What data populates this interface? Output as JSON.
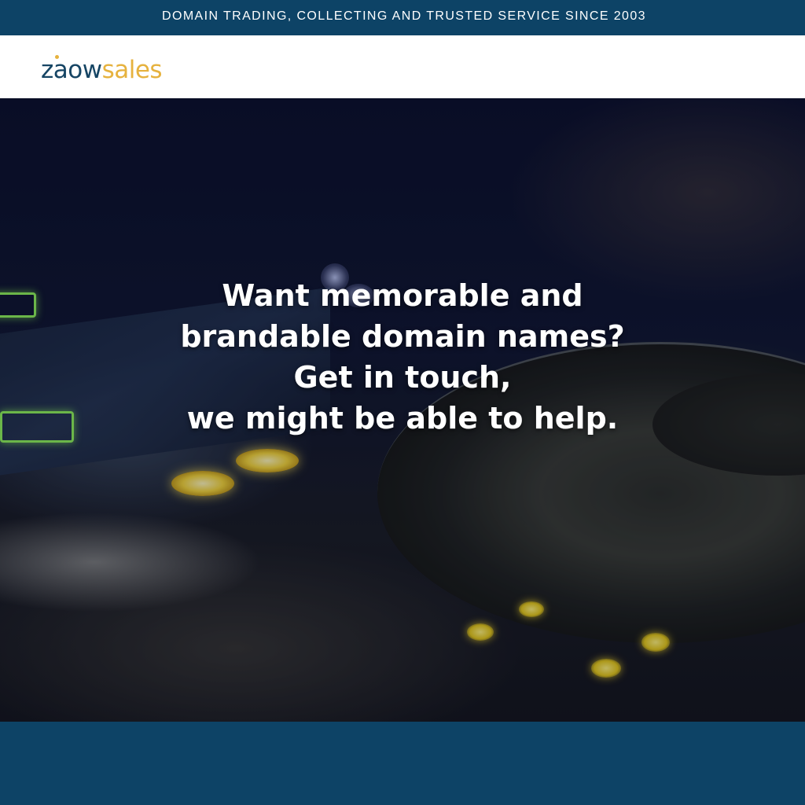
{
  "topbar": {
    "tagline": "DOMAIN TRADING, COLLECTING AND TRUSTED SERVICE SINCE 2003"
  },
  "header": {
    "logo": {
      "part1": "zaow",
      "part2": "sales"
    }
  },
  "hero": {
    "headline_lines": [
      "Want memorable and",
      "brandable domain names?",
      "Get in touch,",
      "we might be able to help."
    ],
    "background_image": "dj-turntable-controller-photo"
  },
  "colors": {
    "brand_navy": "#0d4366",
    "brand_gold": "#e6b23e",
    "header_bg": "#ffffff",
    "headline_text": "#ffffff"
  }
}
